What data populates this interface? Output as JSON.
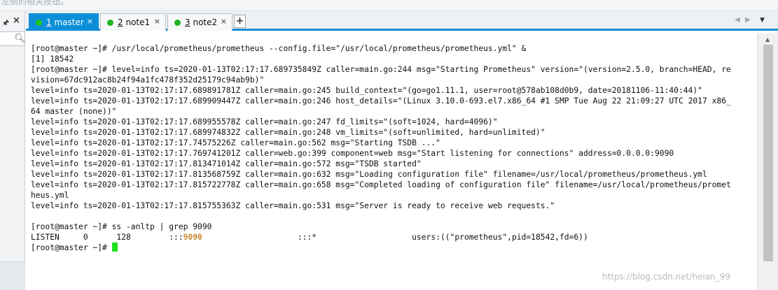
{
  "top_strip": {
    "text": "左侧的相关按钮。"
  },
  "sidebar": {
    "pin_icon": "pin-icon",
    "close_label": "×",
    "search_icon": "⚲"
  },
  "tabs": [
    {
      "number": "1",
      "name": "master",
      "active": true
    },
    {
      "number": "2",
      "name": "note1",
      "active": false
    },
    {
      "number": "3",
      "name": "note2",
      "active": false
    }
  ],
  "tab_close": "×",
  "tab_add": "+",
  "tab_nav": {
    "prev": "◀",
    "next": "▶",
    "menu": "▼"
  },
  "terminal": {
    "lines": [
      "[root@master ~]# /usr/local/prometheus/prometheus --config.file=\"/usr/local/prometheus/prometheus.yml\" &",
      "[1] 18542",
      "[root@master ~]# level=info ts=2020-01-13T02:17:17.689735849Z caller=main.go:244 msg=\"Starting Prometheus\" version=\"(version=2.5.0, branch=HEAD, re",
      "vision=67dc912ac8b24f94a1fc478f352d25179c94ab9b)\"",
      "level=info ts=2020-01-13T02:17:17.689891781Z caller=main.go:245 build_context=\"(go=go1.11.1, user=root@578ab108d0b9, date=20181106-11:40:44)\"",
      "level=info ts=2020-01-13T02:17:17.689909447Z caller=main.go:246 host_details=\"(Linux 3.10.0-693.el7.x86_64 #1 SMP Tue Aug 22 21:09:27 UTC 2017 x86_",
      "64 master (none))\"",
      "level=info ts=2020-01-13T02:17:17.689955578Z caller=main.go:247 fd_limits=\"(soft=1024, hard=4096)\"",
      "level=info ts=2020-01-13T02:17:17.689974832Z caller=main.go:248 vm_limits=\"(soft=unlimited, hard=unlimited)\"",
      "level=info ts=2020-01-13T02:17:17.74575226Z caller=main.go:562 msg=\"Starting TSDB ...\"",
      "level=info ts=2020-01-13T02:17:17.769741201Z caller=web.go:399 component=web msg=\"Start listening for connections\" address=0.0.0.0:9090",
      "level=info ts=2020-01-13T02:17:17.813471014Z caller=main.go:572 msg=\"TSDB started\"",
      "level=info ts=2020-01-13T02:17:17.813568759Z caller=main.go:632 msg=\"Loading configuration file\" filename=/usr/local/prometheus/prometheus.yml",
      "level=info ts=2020-01-13T02:17:17.815722778Z caller=main.go:658 msg=\"Completed loading of configuration file\" filename=/usr/local/prometheus/promet",
      "heus.yml",
      "level=info ts=2020-01-13T02:17:17.815755363Z caller=main.go:531 msg=\"Server is ready to receive web requests.\"",
      "",
      "[root@master ~]# ss -anltp | grep 9090"
    ],
    "listen_line": {
      "prefix": "LISTEN     0      128        :::",
      "port": "9090",
      "suffix": "                    :::*                    users:((\"prometheus\",pid=18542,fd=6))"
    },
    "prompt": "[root@master ~]# "
  },
  "colors": {
    "tab_active": "#0d8fd8",
    "status_dot": "#1fb41f",
    "cursor": "#1fe11f",
    "highlight": "#c9882f"
  },
  "watermark": "https://blog.csdn.net/heian_99"
}
